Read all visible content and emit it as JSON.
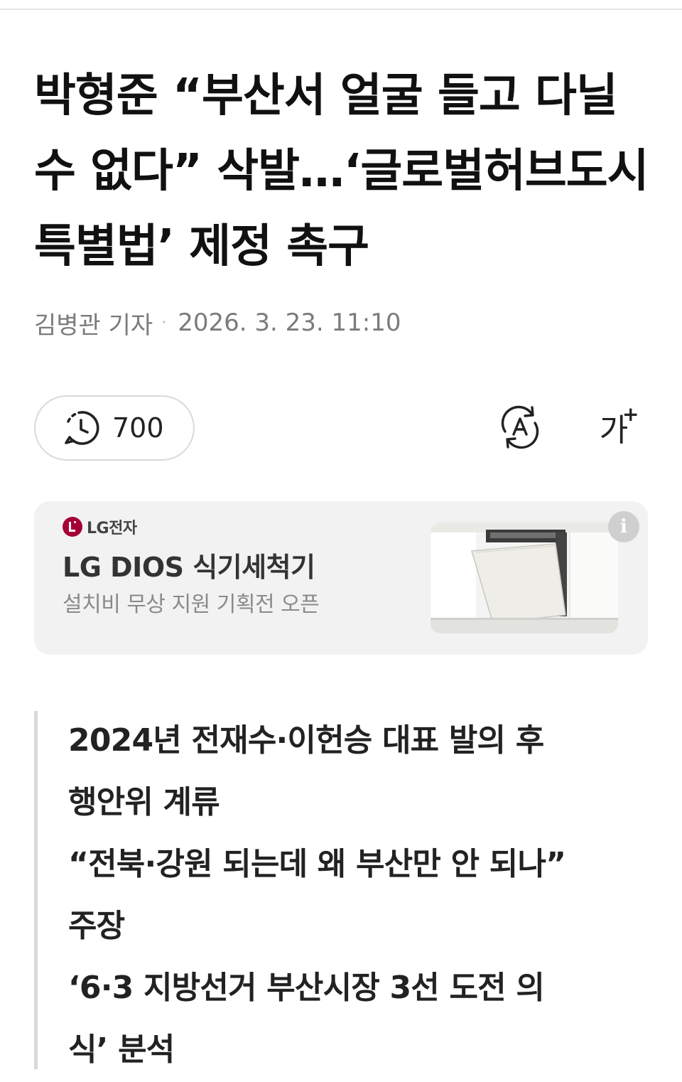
{
  "article": {
    "headline": "박형준 “부산서 얼굴 들고 다닐 수 없다” 삭발…‘글로벌허브도시특별법’ 제정 촉구",
    "reporter": "김병관 기자",
    "byline_separator": "·",
    "datetime": "2026. 3. 23. 11:10"
  },
  "toolbar": {
    "view_count": "700",
    "view_icon": "clock-chat-icon",
    "translate_icon": "translate-icon",
    "font_size_label": "가",
    "font_size_plus": "+"
  },
  "ad": {
    "brand": "LG전자",
    "title": "LG DIOS 식기세척기",
    "subtitle": "설치비 무상 지원 기획전 오픈",
    "info_label": "i",
    "brand_color": "#a50034"
  },
  "summary": {
    "lines": [
      "2024년 전재수·이헌승 대표 발의 후",
      "행안위 계류",
      "“전북·강원 되는데 왜 부산만 안 되나”",
      "주장",
      "‘6·3 지방선거 부산시장 3선 도전 의",
      "식’ 분석"
    ]
  }
}
